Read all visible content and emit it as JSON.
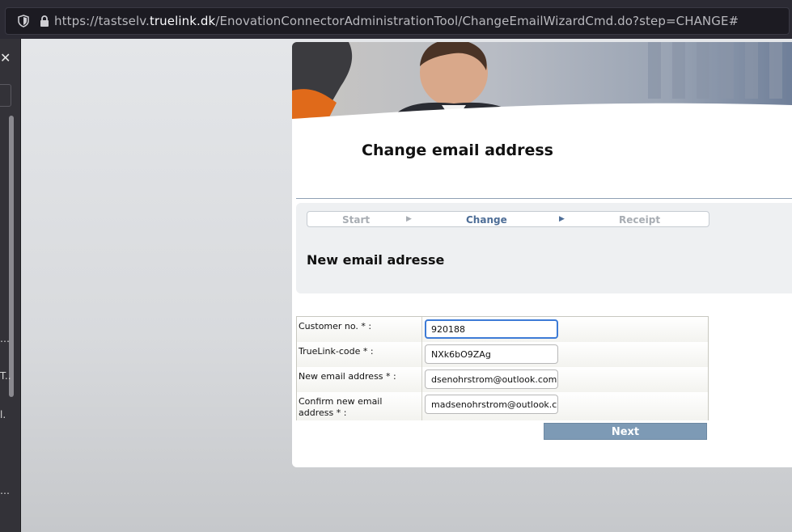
{
  "browser": {
    "url_prefix": "https://tastselv.",
    "url_host": "truelink.dk",
    "url_path": "/EnovationConnectorAdministrationTool/ChangeEmailWizardCmd.do?step=CHANGE#"
  },
  "sidebar": {
    "close_label": "✕",
    "truncated": [
      "…",
      "T..",
      "l.",
      "…"
    ]
  },
  "page": {
    "title": "Change email address",
    "steps": [
      {
        "label": "Start",
        "state": "done"
      },
      {
        "label": "Change",
        "state": "active"
      },
      {
        "label": "Receipt",
        "state": "pending"
      }
    ],
    "section_title": "New email adresse"
  },
  "form": {
    "rows": [
      {
        "label": "Customer no. * :",
        "value": "920188"
      },
      {
        "label": "TrueLink-code * :",
        "value": "NXk6bO9ZAg"
      },
      {
        "label": "New email address * :",
        "value": "dsenohrstrom@outlook.com"
      },
      {
        "label": "Confirm new email address * :",
        "value": "madsenohrstrom@outlook.com"
      }
    ],
    "submit_label": "Next"
  },
  "colors": {
    "accent": "#4e6e97",
    "button": "#7d9ab5",
    "focus": "#3d7bd6"
  }
}
